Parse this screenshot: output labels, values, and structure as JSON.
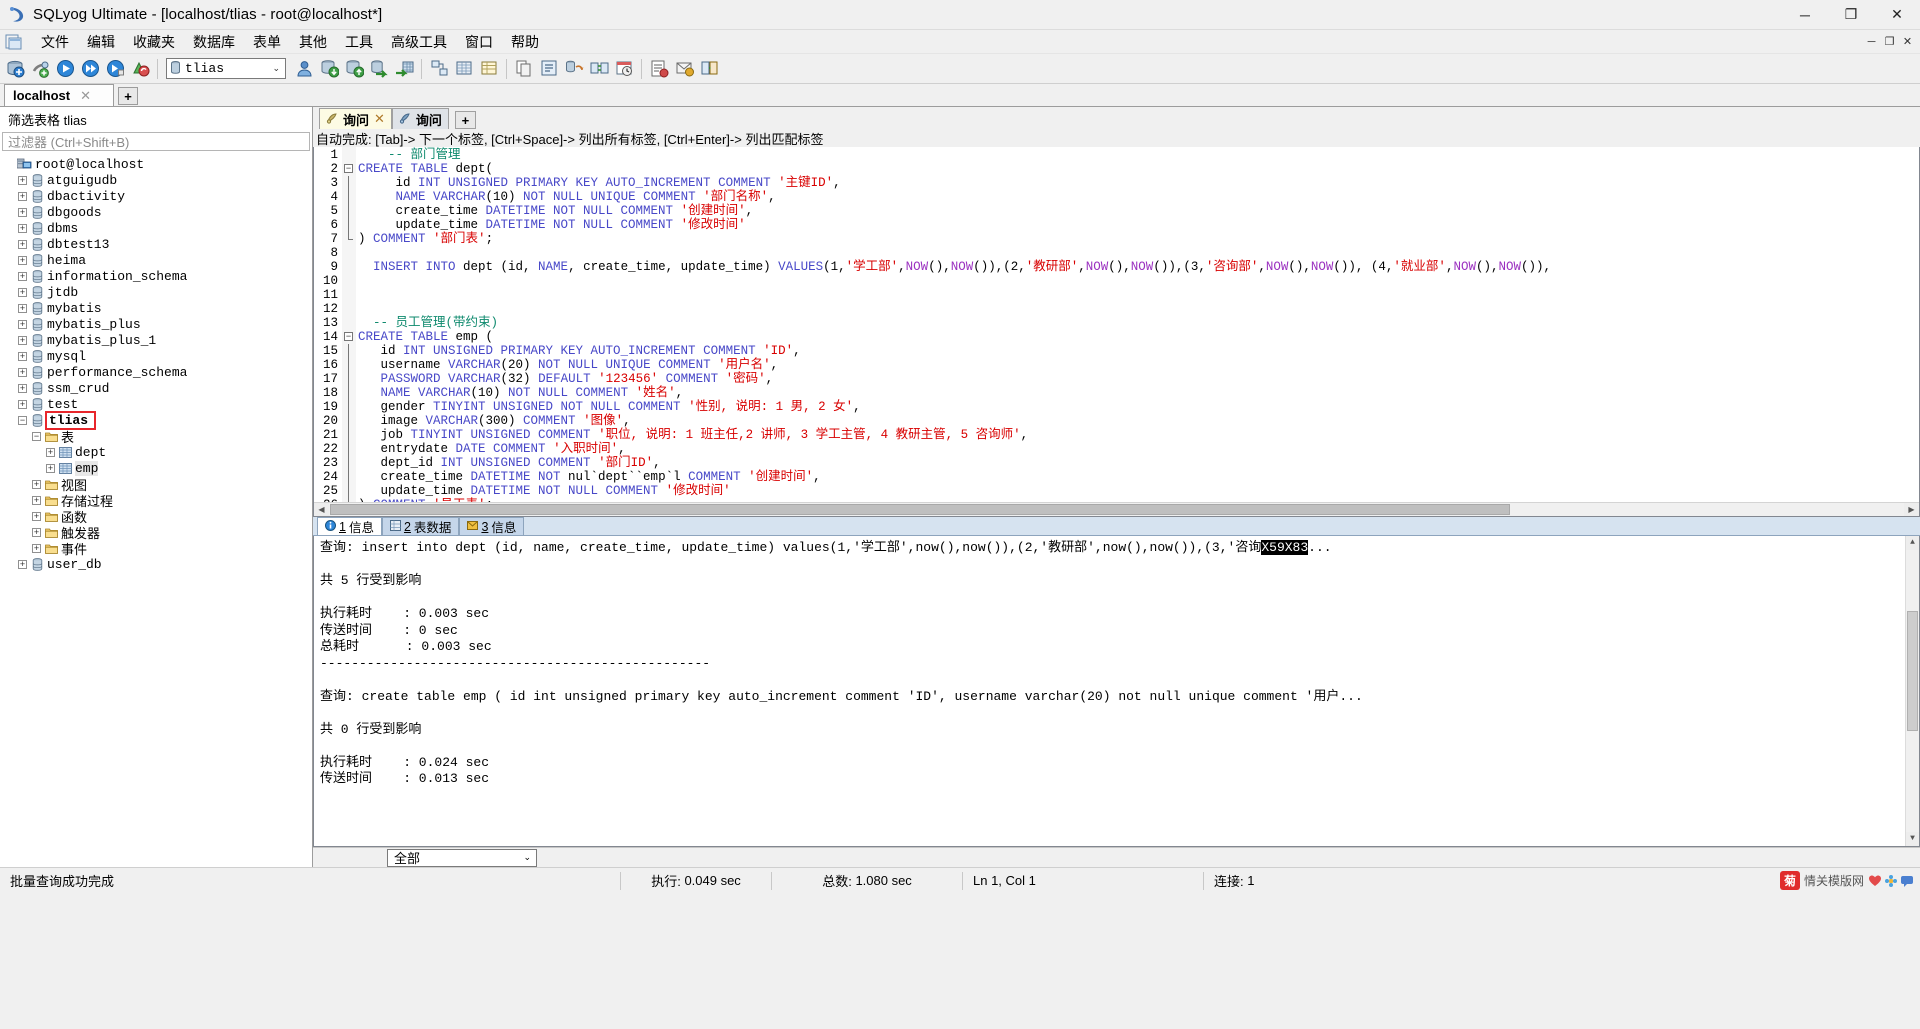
{
  "window": {
    "title": "SQLyog Ultimate - [localhost/tlias - root@localhost*]",
    "app_icon": "sqlyog-logo-icon",
    "minimize": "─",
    "maximize": "❐",
    "close": "✕"
  },
  "menubar": {
    "doc_icon": "window-document-icon",
    "items": [
      "文件",
      "编辑",
      "收藏夹",
      "数据库",
      "表单",
      "其他",
      "工具",
      "高级工具",
      "窗口",
      "帮助"
    ],
    "mdi_buttons": [
      "─",
      "❐",
      "✕"
    ]
  },
  "toolbar": {
    "db_combo": {
      "value": "tlias",
      "icon": "database-icon",
      "arrow": "⌄"
    },
    "buttons": [
      "new-connection-icon",
      "new-object-icon",
      "execute-query-icon",
      "execute-all-icon",
      "execute-current-icon",
      "refresh-objects-icon",
      "user-manager-icon",
      "backup-database-icon",
      "restore-database-icon",
      "import-external-icon",
      "export-table-icon",
      "schema-designer-icon",
      "table-diagnostics-icon",
      "table-data-icon",
      "copy-database-icon",
      "query-builder-icon",
      "schema-sync-icon",
      "data-sync-icon",
      "scheduled-backup-icon",
      "sql-formatter-icon",
      "notification-services-icon",
      "migration-toolkit-icon"
    ]
  },
  "connection_tabs": {
    "tabs": [
      {
        "label": "localhost",
        "close": "✕"
      }
    ],
    "add_label": "+"
  },
  "left_panel": {
    "filter_label": "筛选表格 tlias",
    "filter_placeholder": "过滤器 (Ctrl+Shift+B)",
    "tree": [
      {
        "label": "root@localhost",
        "depth": 0,
        "toggle": "none",
        "icon": "server-icon"
      },
      {
        "label": "atguigudb",
        "depth": 1,
        "toggle": "plus",
        "icon": "database-icon"
      },
      {
        "label": "dbactivity",
        "depth": 1,
        "toggle": "plus",
        "icon": "database-icon"
      },
      {
        "label": "dbgoods",
        "depth": 1,
        "toggle": "plus",
        "icon": "database-icon"
      },
      {
        "label": "dbms",
        "depth": 1,
        "toggle": "plus",
        "icon": "database-icon"
      },
      {
        "label": "dbtest13",
        "depth": 1,
        "toggle": "plus",
        "icon": "database-icon"
      },
      {
        "label": "heima",
        "depth": 1,
        "toggle": "plus",
        "icon": "database-icon"
      },
      {
        "label": "information_schema",
        "depth": 1,
        "toggle": "plus",
        "icon": "database-icon"
      },
      {
        "label": "jtdb",
        "depth": 1,
        "toggle": "plus",
        "icon": "database-icon"
      },
      {
        "label": "mybatis",
        "depth": 1,
        "toggle": "plus",
        "icon": "database-icon"
      },
      {
        "label": "mybatis_plus",
        "depth": 1,
        "toggle": "plus",
        "icon": "database-icon"
      },
      {
        "label": "mybatis_plus_1",
        "depth": 1,
        "toggle": "plus",
        "icon": "database-icon"
      },
      {
        "label": "mysql",
        "depth": 1,
        "toggle": "plus",
        "icon": "database-icon"
      },
      {
        "label": "performance_schema",
        "depth": 1,
        "toggle": "plus",
        "icon": "database-icon"
      },
      {
        "label": "ssm_crud",
        "depth": 1,
        "toggle": "plus",
        "icon": "database-icon"
      },
      {
        "label": "test",
        "depth": 1,
        "toggle": "plus",
        "icon": "database-icon"
      },
      {
        "label": "tlias",
        "depth": 1,
        "toggle": "minus",
        "icon": "database-icon",
        "highlight": true
      },
      {
        "label": "表",
        "depth": 2,
        "toggle": "minus",
        "icon": "folder-icon"
      },
      {
        "label": "dept",
        "depth": 3,
        "toggle": "plus",
        "icon": "table-icon"
      },
      {
        "label": "emp",
        "depth": 3,
        "toggle": "plus",
        "icon": "table-icon",
        "selected": true
      },
      {
        "label": "视图",
        "depth": 2,
        "toggle": "plus",
        "icon": "folder-icon"
      },
      {
        "label": "存储过程",
        "depth": 2,
        "toggle": "plus",
        "icon": "folder-icon"
      },
      {
        "label": "函数",
        "depth": 2,
        "toggle": "plus",
        "icon": "folder-icon"
      },
      {
        "label": "触发器",
        "depth": 2,
        "toggle": "plus",
        "icon": "folder-icon"
      },
      {
        "label": "事件",
        "depth": 2,
        "toggle": "plus",
        "icon": "folder-icon"
      },
      {
        "label": "user_db",
        "depth": 1,
        "toggle": "plus",
        "icon": "database-icon"
      }
    ]
  },
  "query_tabs": {
    "tabs": [
      {
        "label": "询问",
        "active": true,
        "close": "✕",
        "icon": "query-tab-icon"
      },
      {
        "label": "询问",
        "active": false,
        "close": "",
        "icon": "query-tab-icon"
      }
    ],
    "add_label": "+"
  },
  "autocomplete_hint": "自动完成: [Tab]-> 下一个标签, [Ctrl+Space]-> 列出所有标签, [Ctrl+Enter]-> 列出匹配标签",
  "editor": {
    "lines": [
      {
        "n": 1,
        "tokens": [
          {
            "t": "    ",
            "c": "pl"
          },
          {
            "t": "-- 部门管理",
            "c": "cm"
          }
        ]
      },
      {
        "n": 2,
        "fold": "start",
        "tokens": [
          {
            "t": "CREATE TABLE",
            "c": "k"
          },
          {
            "t": " dept(",
            "c": "pl"
          }
        ]
      },
      {
        "n": 3,
        "fold": "bar",
        "tokens": [
          {
            "t": "     id ",
            "c": "pl"
          },
          {
            "t": "INT UNSIGNED PRIMARY KEY AUTO_INCREMENT COMMENT",
            "c": "k"
          },
          {
            "t": " ",
            "c": "pl"
          },
          {
            "t": "'主键ID'",
            "c": "str"
          },
          {
            "t": ",",
            "c": "pl"
          }
        ]
      },
      {
        "n": 4,
        "fold": "bar",
        "tokens": [
          {
            "t": "     ",
            "c": "pl"
          },
          {
            "t": "NAME VARCHAR",
            "c": "k"
          },
          {
            "t": "(10) ",
            "c": "pl"
          },
          {
            "t": "NOT NULL UNIQUE COMMENT",
            "c": "k"
          },
          {
            "t": " ",
            "c": "pl"
          },
          {
            "t": "'部门名称'",
            "c": "str"
          },
          {
            "t": ",",
            "c": "pl"
          }
        ]
      },
      {
        "n": 5,
        "fold": "bar",
        "tokens": [
          {
            "t": "     create_time ",
            "c": "pl"
          },
          {
            "t": "DATETIME NOT NULL COMMENT",
            "c": "k"
          },
          {
            "t": " ",
            "c": "pl"
          },
          {
            "t": "'创建时间'",
            "c": "str"
          },
          {
            "t": ",",
            "c": "pl"
          }
        ]
      },
      {
        "n": 6,
        "fold": "bar",
        "tokens": [
          {
            "t": "     update_time ",
            "c": "pl"
          },
          {
            "t": "DATETIME NOT NULL COMMENT",
            "c": "k"
          },
          {
            "t": " ",
            "c": "pl"
          },
          {
            "t": "'修改时间'",
            "c": "str"
          }
        ]
      },
      {
        "n": 7,
        "fold": "end",
        "tokens": [
          {
            "t": ") ",
            "c": "pl"
          },
          {
            "t": "COMMENT",
            "c": "k"
          },
          {
            "t": " ",
            "c": "pl"
          },
          {
            "t": "'部门表'",
            "c": "str"
          },
          {
            "t": ";",
            "c": "pl"
          }
        ]
      },
      {
        "n": 8,
        "tokens": []
      },
      {
        "n": 9,
        "tokens": [
          {
            "t": "  ",
            "c": "pl"
          },
          {
            "t": "INSERT INTO",
            "c": "k"
          },
          {
            "t": " dept (id, ",
            "c": "pl"
          },
          {
            "t": "NAME",
            "c": "k"
          },
          {
            "t": ", create_time, update_time) ",
            "c": "pl"
          },
          {
            "t": "VALUES",
            "c": "k"
          },
          {
            "t": "(1,",
            "c": "pl"
          },
          {
            "t": "'学工部'",
            "c": "str"
          },
          {
            "t": ",",
            "c": "pl"
          },
          {
            "t": "NOW",
            "c": "kw2"
          },
          {
            "t": "(),",
            "c": "pl"
          },
          {
            "t": "NOW",
            "c": "kw2"
          },
          {
            "t": "()),(2,",
            "c": "pl"
          },
          {
            "t": "'教研部'",
            "c": "str"
          },
          {
            "t": ",",
            "c": "pl"
          },
          {
            "t": "NOW",
            "c": "kw2"
          },
          {
            "t": "(),",
            "c": "pl"
          },
          {
            "t": "NOW",
            "c": "kw2"
          },
          {
            "t": "()),(3,",
            "c": "pl"
          },
          {
            "t": "'咨询部'",
            "c": "str"
          },
          {
            "t": ",",
            "c": "pl"
          },
          {
            "t": "NOW",
            "c": "kw2"
          },
          {
            "t": "(),",
            "c": "pl"
          },
          {
            "t": "NOW",
            "c": "kw2"
          },
          {
            "t": "()), (4,",
            "c": "pl"
          },
          {
            "t": "'就业部'",
            "c": "str"
          },
          {
            "t": ",",
            "c": "pl"
          },
          {
            "t": "NOW",
            "c": "kw2"
          },
          {
            "t": "(),",
            "c": "pl"
          },
          {
            "t": "NOW",
            "c": "kw2"
          },
          {
            "t": "()),",
            "c": "pl"
          }
        ]
      },
      {
        "n": 10,
        "tokens": []
      },
      {
        "n": 11,
        "tokens": []
      },
      {
        "n": 12,
        "tokens": []
      },
      {
        "n": 13,
        "tokens": [
          {
            "t": "  ",
            "c": "pl"
          },
          {
            "t": "-- 员工管理(带约束)",
            "c": "cm"
          }
        ]
      },
      {
        "n": 14,
        "fold": "start",
        "tokens": [
          {
            "t": "CREATE TABLE",
            "c": "k"
          },
          {
            "t": " emp (",
            "c": "pl"
          }
        ]
      },
      {
        "n": 15,
        "fold": "bar",
        "tokens": [
          {
            "t": "   id ",
            "c": "pl"
          },
          {
            "t": "INT UNSIGNED PRIMARY KEY AUTO_INCREMENT COMMENT",
            "c": "k"
          },
          {
            "t": " ",
            "c": "pl"
          },
          {
            "t": "'ID'",
            "c": "str"
          },
          {
            "t": ",",
            "c": "pl"
          }
        ]
      },
      {
        "n": 16,
        "fold": "bar",
        "tokens": [
          {
            "t": "   username ",
            "c": "pl"
          },
          {
            "t": "VARCHAR",
            "c": "k"
          },
          {
            "t": "(20) ",
            "c": "pl"
          },
          {
            "t": "NOT NULL UNIQUE COMMENT",
            "c": "k"
          },
          {
            "t": " ",
            "c": "pl"
          },
          {
            "t": "'用户名'",
            "c": "str"
          },
          {
            "t": ",",
            "c": "pl"
          }
        ]
      },
      {
        "n": 17,
        "fold": "bar",
        "tokens": [
          {
            "t": "   ",
            "c": "pl"
          },
          {
            "t": "PASSWORD VARCHAR",
            "c": "k"
          },
          {
            "t": "(32) ",
            "c": "pl"
          },
          {
            "t": "DEFAULT",
            "c": "k"
          },
          {
            "t": " ",
            "c": "pl"
          },
          {
            "t": "'123456'",
            "c": "str"
          },
          {
            "t": " ",
            "c": "pl"
          },
          {
            "t": "COMMENT",
            "c": "k"
          },
          {
            "t": " ",
            "c": "pl"
          },
          {
            "t": "'密码'",
            "c": "str"
          },
          {
            "t": ",",
            "c": "pl"
          }
        ]
      },
      {
        "n": 18,
        "fold": "bar",
        "tokens": [
          {
            "t": "   ",
            "c": "pl"
          },
          {
            "t": "NAME VARCHAR",
            "c": "k"
          },
          {
            "t": "(10) ",
            "c": "pl"
          },
          {
            "t": "NOT NULL COMMENT",
            "c": "k"
          },
          {
            "t": " ",
            "c": "pl"
          },
          {
            "t": "'姓名'",
            "c": "str"
          },
          {
            "t": ",",
            "c": "pl"
          }
        ]
      },
      {
        "n": 19,
        "fold": "bar",
        "tokens": [
          {
            "t": "   gender ",
            "c": "pl"
          },
          {
            "t": "TINYINT UNSIGNED NOT NULL COMMENT",
            "c": "k"
          },
          {
            "t": " ",
            "c": "pl"
          },
          {
            "t": "'性别, 说明: 1 男, 2 女'",
            "c": "str"
          },
          {
            "t": ",",
            "c": "pl"
          }
        ]
      },
      {
        "n": 20,
        "fold": "bar",
        "tokens": [
          {
            "t": "   image ",
            "c": "pl"
          },
          {
            "t": "VARCHAR",
            "c": "k"
          },
          {
            "t": "(300) ",
            "c": "pl"
          },
          {
            "t": "COMMENT",
            "c": "k"
          },
          {
            "t": " ",
            "c": "pl"
          },
          {
            "t": "'图像'",
            "c": "str"
          },
          {
            "t": ",",
            "c": "pl"
          }
        ]
      },
      {
        "n": 21,
        "fold": "bar",
        "tokens": [
          {
            "t": "   job ",
            "c": "pl"
          },
          {
            "t": "TINYINT UNSIGNED COMMENT",
            "c": "k"
          },
          {
            "t": " ",
            "c": "pl"
          },
          {
            "t": "'职位, 说明: 1 班主任,2 讲师, 3 学工主管, 4 教研主管, 5 咨询师'",
            "c": "str"
          },
          {
            "t": ",",
            "c": "pl"
          }
        ]
      },
      {
        "n": 22,
        "fold": "bar",
        "tokens": [
          {
            "t": "   entrydate ",
            "c": "pl"
          },
          {
            "t": "DATE COMMENT",
            "c": "k"
          },
          {
            "t": " ",
            "c": "pl"
          },
          {
            "t": "'入职时间'",
            "c": "str"
          },
          {
            "t": ",",
            "c": "pl"
          }
        ]
      },
      {
        "n": 23,
        "fold": "bar",
        "tokens": [
          {
            "t": "   dept_id ",
            "c": "pl"
          },
          {
            "t": "INT UNSIGNED COMMENT",
            "c": "k"
          },
          {
            "t": " ",
            "c": "pl"
          },
          {
            "t": "'部门ID'",
            "c": "str"
          },
          {
            "t": ",",
            "c": "pl"
          }
        ]
      },
      {
        "n": 24,
        "fold": "bar",
        "tokens": [
          {
            "t": "   create_time ",
            "c": "pl"
          },
          {
            "t": "DATETIME NOT",
            "c": "k"
          },
          {
            "t": " nul`dept``emp`l ",
            "c": "pl"
          },
          {
            "t": "COMMENT",
            "c": "k"
          },
          {
            "t": " ",
            "c": "pl"
          },
          {
            "t": "'创建时间'",
            "c": "str"
          },
          {
            "t": ",",
            "c": "pl"
          }
        ]
      },
      {
        "n": 25,
        "fold": "bar",
        "tokens": [
          {
            "t": "   update_time ",
            "c": "pl"
          },
          {
            "t": "DATETIME NOT NULL COMMENT",
            "c": "k"
          },
          {
            "t": " ",
            "c": "pl"
          },
          {
            "t": "'修改时间'",
            "c": "str"
          }
        ]
      },
      {
        "n": 26,
        "fold": "end",
        "tokens": [
          {
            "t": ") ",
            "c": "pl"
          },
          {
            "t": "COMMENT",
            "c": "k"
          },
          {
            "t": " ",
            "c": "pl"
          },
          {
            "t": "'员工表'",
            "c": "str"
          },
          {
            "t": ";",
            "c": "pl"
          }
        ]
      }
    ]
  },
  "result_tabs": [
    {
      "num": "1",
      "label": "信息",
      "icon": "info-icon",
      "active": true
    },
    {
      "num": "2",
      "label": "表数据",
      "icon": "grid-icon",
      "active": false
    },
    {
      "num": "3",
      "label": "信息",
      "icon": "message-icon",
      "active": false
    }
  ],
  "result_text": [
    {
      "text": "查询: insert into dept (id, name, create_time, update_time) values(1,'学工部',now(),now()),(2,'教研部',now(),now()),(3,'咨询",
      "inverted": "X59X83",
      "suffix": "..."
    },
    {
      "text": ""
    },
    {
      "text": "共 5 行受到影响"
    },
    {
      "text": ""
    },
    {
      "text": "执行耗时    : 0.003 sec"
    },
    {
      "text": "传送时间    : 0 sec"
    },
    {
      "text": "总耗时      : 0.003 sec"
    },
    {
      "text": "--------------------------------------------------"
    },
    {
      "text": ""
    },
    {
      "text": "查询: create table emp ( id int unsigned primary key auto_increment comment 'ID', username varchar(20) not null unique comment '用户...",
      "suffix": ""
    },
    {
      "text": ""
    },
    {
      "text": "共 0 行受到影响"
    },
    {
      "text": ""
    },
    {
      "text": "执行耗时    : 0.024 sec"
    },
    {
      "text": "传送时间    : 0.013 sec"
    }
  ],
  "bottom_filter": {
    "value": "全部",
    "arrow": "⌄"
  },
  "statusbar": {
    "message": "批量查询成功完成",
    "exec_label": "执行:",
    "exec_value": "0.049 sec",
    "total_label": "总数:",
    "total_value": "1.080 sec",
    "cursor": "Ln 1, Col 1",
    "conn_label": "连接:",
    "conn_value": "1",
    "watermark_badge": "菊",
    "watermark_text": "情关模版网",
    "watermark_icons": [
      "heart-icon",
      "flower-icon",
      "chat-icon"
    ]
  }
}
